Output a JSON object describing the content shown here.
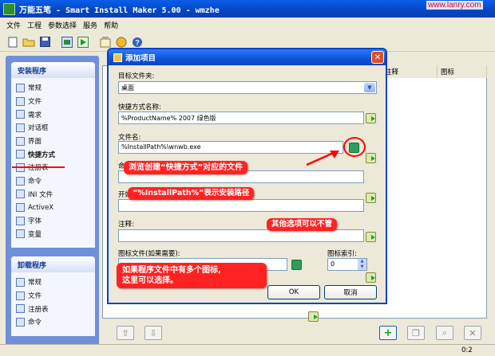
{
  "app": {
    "title": "万能五笔 - Smart Install Maker 5.00 - wmzhe",
    "watermark": "www.lanry.com"
  },
  "menu": [
    "文件",
    "工程",
    "参数选择",
    "服务",
    "帮助"
  ],
  "toolbar": {
    "icons": [
      "new-icon",
      "open-icon",
      "save-icon",
      "build-icon",
      "run-icon",
      "options-icon",
      "web-icon",
      "help-icon"
    ]
  },
  "sidebar": {
    "install_title": "安装程序",
    "install_items": [
      {
        "label": "常规",
        "icon": "general-icon"
      },
      {
        "label": "文件",
        "icon": "files-icon"
      },
      {
        "label": "需求",
        "icon": "requirements-icon"
      },
      {
        "label": "对话框",
        "icon": "dialogs-icon"
      },
      {
        "label": "界面",
        "icon": "interface-icon"
      },
      {
        "label": "快捷方式",
        "icon": "shortcut-icon"
      },
      {
        "label": "注册表",
        "icon": "registry-icon"
      },
      {
        "label": "命令",
        "icon": "command-icon"
      },
      {
        "label": "INI 文件",
        "icon": "ini-file-icon"
      },
      {
        "label": "ActiveX",
        "icon": "activex-icon"
      },
      {
        "label": "字体",
        "icon": "font-icon"
      },
      {
        "label": "变量",
        "icon": "variable-icon"
      }
    ],
    "selected": "快捷方式",
    "uninstall_title": "卸载程序",
    "uninstall_items": [
      {
        "label": "常规",
        "icon": "general-icon"
      },
      {
        "label": "文件",
        "icon": "files-icon"
      },
      {
        "label": "注册表",
        "icon": "registry-icon"
      },
      {
        "label": "命令",
        "icon": "command-icon"
      }
    ]
  },
  "list": {
    "columns": [
      "注释",
      "图标"
    ]
  },
  "dialog": {
    "title": "添加项目",
    "target_folder_label": "目标文件夹:",
    "target_folder_value": "桌面",
    "shortcut_name_label": "快捷方式名称:",
    "shortcut_name_value": "%ProductName% 2007 绿色版",
    "file_name_label": "文件名:",
    "file_name_value": "%InstallPath%\\wnwb.exe",
    "cmd_label_fragment": "命",
    "start_label_fragment": "开始",
    "comment_label": "注释:",
    "icon_file_label": "图标文件(如果需要):",
    "icon_index_label": "图标索引:",
    "icon_index_value": "0",
    "ok": "OK",
    "cancel": "取消"
  },
  "annotations": {
    "browse": "浏览创建“快捷方式”对应的文件",
    "install_path": "“%InstallPath%”表示安装路径",
    "other_options": "其他选项可以不管",
    "multi_icon_line1": "如果程序文件中有多个图标,",
    "multi_icon_line2": "这里可以选择。"
  },
  "colors": {
    "annotation_bg": "#ff2222",
    "titlebar": "#0a52dc",
    "highlight_circle": "#ff0000"
  },
  "status": {
    "position": "0:2"
  }
}
